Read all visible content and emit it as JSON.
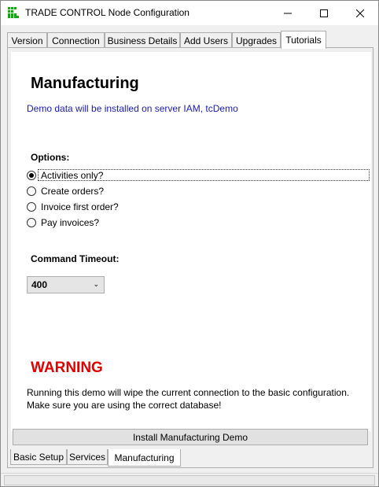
{
  "window": {
    "title": "TRADE CONTROL Node Configuration",
    "icon_name": "app-grid-icon",
    "accent_color": "#1aa11a"
  },
  "top_tabs": [
    {
      "label": "Version"
    },
    {
      "label": "Connection"
    },
    {
      "label": "Business Details"
    },
    {
      "label": "Add Users"
    },
    {
      "label": "Upgrades"
    },
    {
      "label": "Tutorials",
      "active": true
    }
  ],
  "content": {
    "heading": "Manufacturing",
    "info": "Demo data will be installed on server IAM, tcDemo",
    "options_label": "Options:",
    "options": [
      {
        "label": "Activities only?",
        "checked": true
      },
      {
        "label": "Create orders?",
        "checked": false
      },
      {
        "label": "Invoice first order?",
        "checked": false
      },
      {
        "label": "Pay invoices?",
        "checked": false
      }
    ],
    "timeout_label": "Command Timeout:",
    "timeout_value": "400",
    "warning_title": "WARNING",
    "warning_line1": "Running this demo will wipe the current connection to the basic configuration.",
    "warning_line2": "Make sure you are using the correct database!",
    "install_button": "Install Manufacturing Demo"
  },
  "bottom_tabs": [
    {
      "label": "Basic Setup"
    },
    {
      "label": "Services"
    },
    {
      "label": "Manufacturing",
      "active": true
    }
  ],
  "colors": {
    "info_text": "#1a1ab3",
    "warning_text": "#e00000"
  }
}
